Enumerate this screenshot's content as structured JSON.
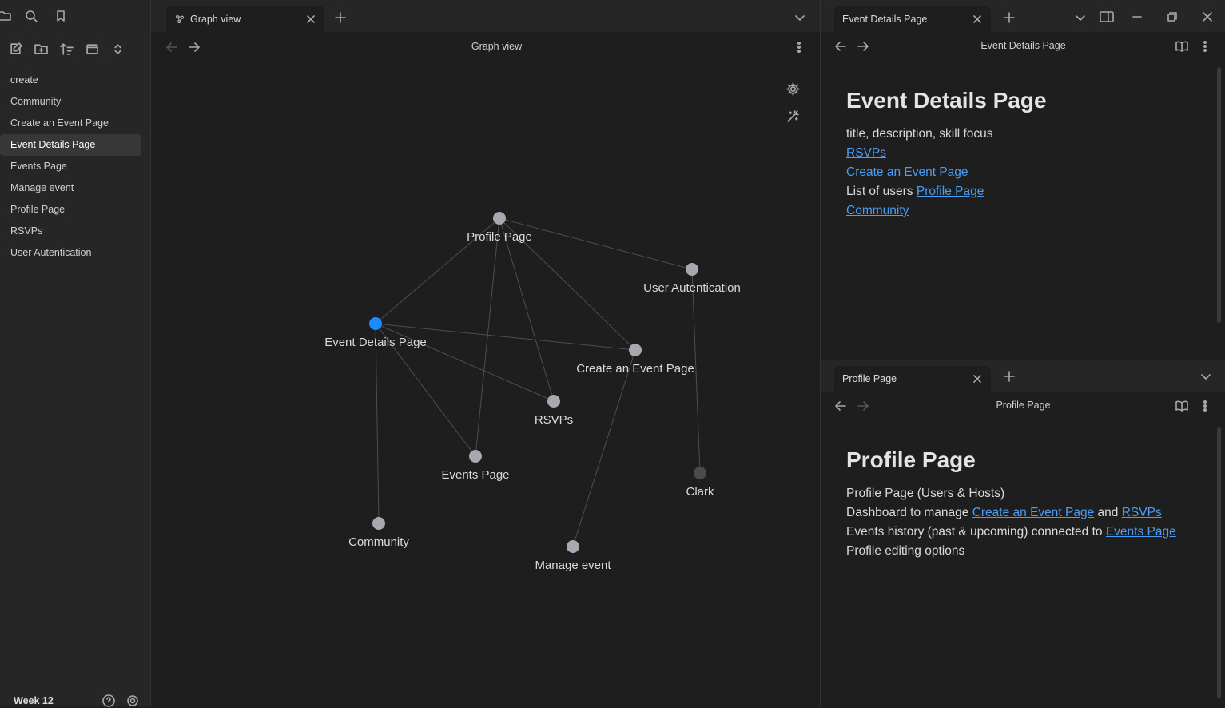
{
  "sidebar": {
    "files": [
      {
        "label": "create",
        "folder": true
      },
      {
        "label": "Community"
      },
      {
        "label": "Create an Event Page"
      },
      {
        "label": "Event Details Page",
        "active": true
      },
      {
        "label": "Events Page"
      },
      {
        "label": "Manage event"
      },
      {
        "label": "Profile Page"
      },
      {
        "label": "RSVPs"
      },
      {
        "label": "User Autentication"
      }
    ],
    "vault_name": "Week 12"
  },
  "left_tabbar": {
    "tab_label": "Graph view"
  },
  "graph": {
    "title": "Graph view",
    "active_color": "#1a8cff",
    "node_color": "#a8a8b0",
    "orphan_color": "#4a4a4a",
    "nodes": [
      {
        "id": "profile",
        "label": "Profile Page"
      },
      {
        "id": "userauth",
        "label": "User Autentication"
      },
      {
        "id": "eventdetails",
        "label": "Event Details Page",
        "active": true
      },
      {
        "id": "create",
        "label": "Create an Event Page"
      },
      {
        "id": "rsvps",
        "label": "RSVPs"
      },
      {
        "id": "events",
        "label": "Events Page"
      },
      {
        "id": "clark",
        "label": "Clark",
        "orphan": true
      },
      {
        "id": "community",
        "label": "Community"
      },
      {
        "id": "manage",
        "label": "Manage event"
      }
    ],
    "edges": [
      [
        "profile",
        "userauth"
      ],
      [
        "profile",
        "eventdetails"
      ],
      [
        "profile",
        "create"
      ],
      [
        "profile",
        "rsvps"
      ],
      [
        "profile",
        "events"
      ],
      [
        "eventdetails",
        "create"
      ],
      [
        "eventdetails",
        "rsvps"
      ],
      [
        "eventdetails",
        "events"
      ],
      [
        "eventdetails",
        "community"
      ],
      [
        "create",
        "manage"
      ],
      [
        "userauth",
        "clark"
      ]
    ]
  },
  "right_top": {
    "tab_label": "Event Details Page",
    "header_title": "Event Details Page",
    "h1": "Event Details Page",
    "line1": "title, description, skill focus",
    "link_rsvps": "RSVPs",
    "link_create": "Create an Event Page",
    "line4_prefix": "List of users ",
    "link_profile": "Profile Page",
    "link_community": "Community"
  },
  "right_bottom": {
    "tab_label": "Profile Page",
    "header_title": "Profile Page",
    "h1": "Profile Page",
    "line1": "Profile Page (Users & Hosts)",
    "line2_prefix": "Dashboard to manage ",
    "line2_link1": "Create an Event Page",
    "line2_mid": " and ",
    "line2_link2": "RSVPs",
    "line3_prefix": "Events history (past & upcoming) connected to ",
    "line3_link": "Events Page",
    "line4": "Profile editing options"
  }
}
